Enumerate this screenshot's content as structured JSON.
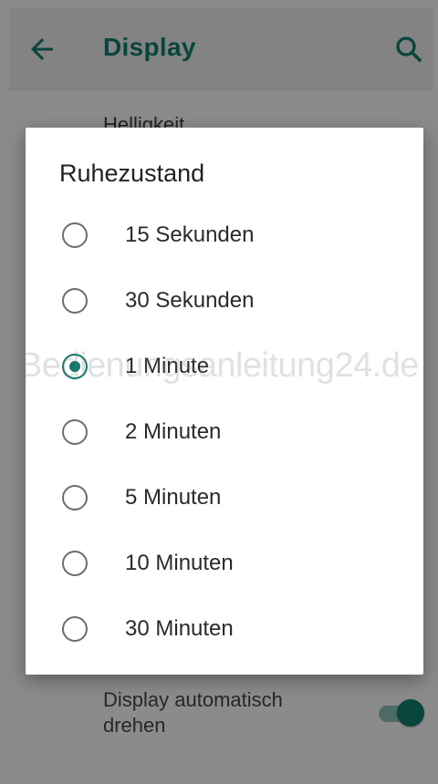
{
  "app_bar": {
    "title": "Display",
    "back_icon": "arrow-left-icon",
    "search_icon": "search-icon"
  },
  "background": {
    "brightness_label": "Helligkeit",
    "auto_rotate_label": "Display automatisch drehen",
    "auto_rotate_on": true
  },
  "dialog": {
    "title": "Ruhezustand",
    "selected_index": 2,
    "options": [
      {
        "label": "15 Sekunden",
        "checked": false
      },
      {
        "label": "30 Sekunden",
        "checked": false
      },
      {
        "label": "1 Minute",
        "checked": true
      },
      {
        "label": "2 Minuten",
        "checked": false
      },
      {
        "label": "5 Minuten",
        "checked": false
      },
      {
        "label": "10 Minuten",
        "checked": false
      },
      {
        "label": "30 Minuten",
        "checked": false
      }
    ]
  },
  "watermark": "Bedienungsanleitung24.de",
  "colors": {
    "accent": "#0d7a6a",
    "title_teal": "#0d6b5d"
  }
}
